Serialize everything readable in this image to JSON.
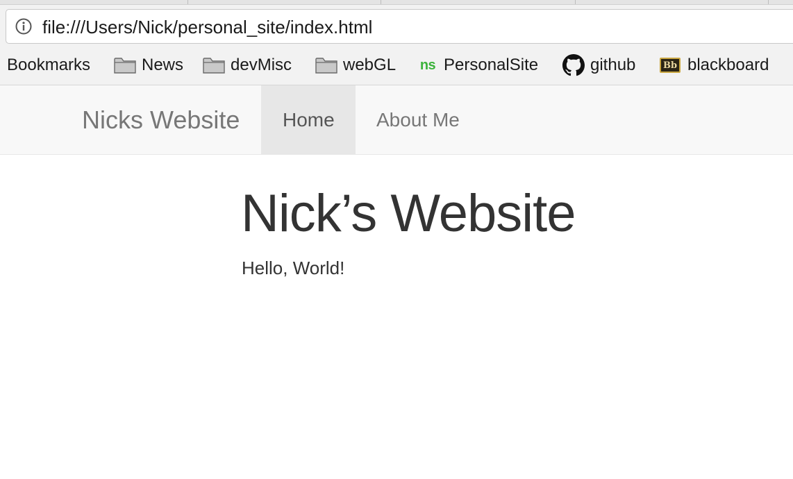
{
  "browser": {
    "url": "file:///Users/Nick/personal_site/index.html",
    "bookmarks": [
      {
        "label": "Bookmarks",
        "icon": "none"
      },
      {
        "label": "News",
        "icon": "folder-icon"
      },
      {
        "label": "devMisc",
        "icon": "folder-icon"
      },
      {
        "label": "webGL",
        "icon": "folder-icon"
      },
      {
        "label": "PersonalSite",
        "icon": "ns-favicon",
        "icon_text": "ns"
      },
      {
        "label": "github",
        "icon": "github-icon"
      },
      {
        "label": "blackboard",
        "icon": "blackboard-icon",
        "icon_text": "Bb"
      }
    ]
  },
  "navbar": {
    "brand": "Nicks Website",
    "items": [
      {
        "label": "Home",
        "active": true
      },
      {
        "label": "About Me",
        "active": false
      }
    ]
  },
  "content": {
    "title": "Nick’s Website",
    "text": "Hello, World!"
  },
  "colors": {
    "navbar_bg": "#f8f8f8",
    "nav_active_bg": "#e7e7e7",
    "nav_text": "#777777",
    "heading_text": "#333333",
    "ns_favicon_green": "#3cb33c"
  }
}
